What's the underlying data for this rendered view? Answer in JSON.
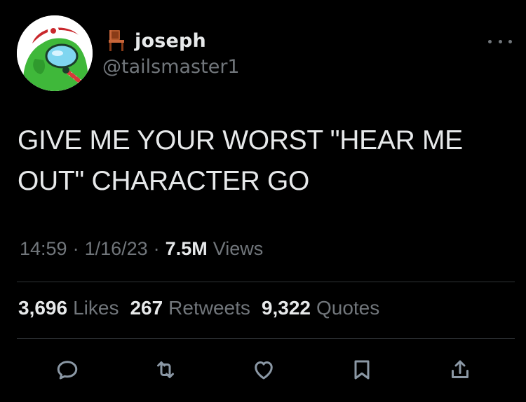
{
  "author": {
    "display_name": "joseph",
    "handle": "@tailsmaster1",
    "name_emoji": "chair-icon",
    "avatar": "green-character-avatar"
  },
  "tweet": {
    "text": "GIVE ME YOUR WORST \"HEAR ME OUT\" CHARACTER GO",
    "time": "14:59",
    "separator": "·",
    "date": "1/16/23",
    "views_count": "7.5M",
    "views_label": "Views"
  },
  "stats": {
    "likes_count": "3,696",
    "likes_label": "Likes",
    "retweets_count": "267",
    "retweets_label": "Retweets",
    "quotes_count": "9,322",
    "quotes_label": "Quotes"
  },
  "actions": [
    {
      "name": "reply-icon"
    },
    {
      "name": "retweet-icon"
    },
    {
      "name": "like-icon"
    },
    {
      "name": "bookmark-icon"
    },
    {
      "name": "share-icon"
    }
  ],
  "colors": {
    "background": "#000000",
    "primary_text": "#e7e9ea",
    "secondary_text": "#71767b",
    "divider": "#2f3336"
  }
}
